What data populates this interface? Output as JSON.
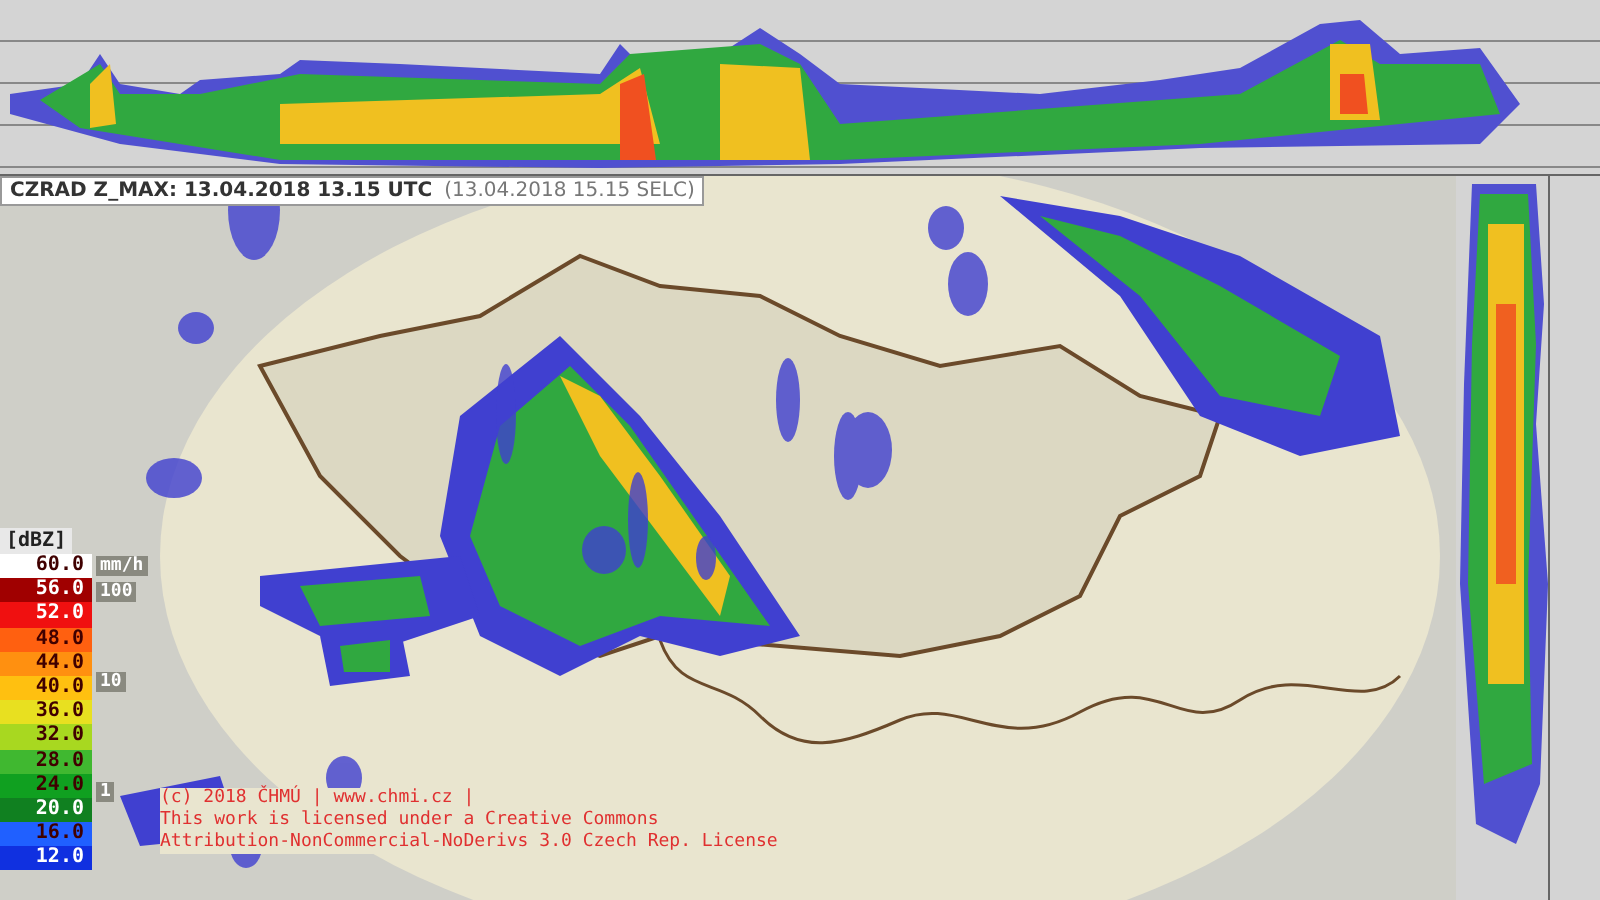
{
  "header": {
    "title": "CZRAD Z_MAX: 13.04.2018 13.15 UTC",
    "local_time": "(13.04.2018 15.15 SELC)"
  },
  "legend": {
    "unit": "[dBZ]",
    "items": [
      {
        "label": "60.0",
        "color": "#ffffff"
      },
      {
        "label": "56.0",
        "color": "#a00000"
      },
      {
        "label": "52.0",
        "color": "#f01010"
      },
      {
        "label": "48.0",
        "color": "#ff6010"
      },
      {
        "label": "44.0",
        "color": "#ff9010"
      },
      {
        "label": "40.0",
        "color": "#ffc010"
      },
      {
        "label": "36.0",
        "color": "#e8e020"
      },
      {
        "label": "32.0",
        "color": "#a8d820"
      },
      {
        "label": "28.0",
        "color": "#40b830"
      },
      {
        "label": "24.0",
        "color": "#10a020"
      },
      {
        "label": "20.0",
        "color": "#108020"
      },
      {
        "label": "16.0",
        "color": "#2060ff"
      },
      {
        "label": "12.0",
        "color": "#1030e0"
      }
    ],
    "rain_unit": "mm/h",
    "rain_ticks": [
      "100",
      "10",
      "1"
    ]
  },
  "copyright": {
    "line_1": "(c) 2018 ČHMÚ | www.chmi.cz |",
    "line_2": "This work is licensed under a Creative Commons",
    "line_3": "Attribution-NonCommercial-NoDerivs 3.0 Czech Rep. License"
  }
}
